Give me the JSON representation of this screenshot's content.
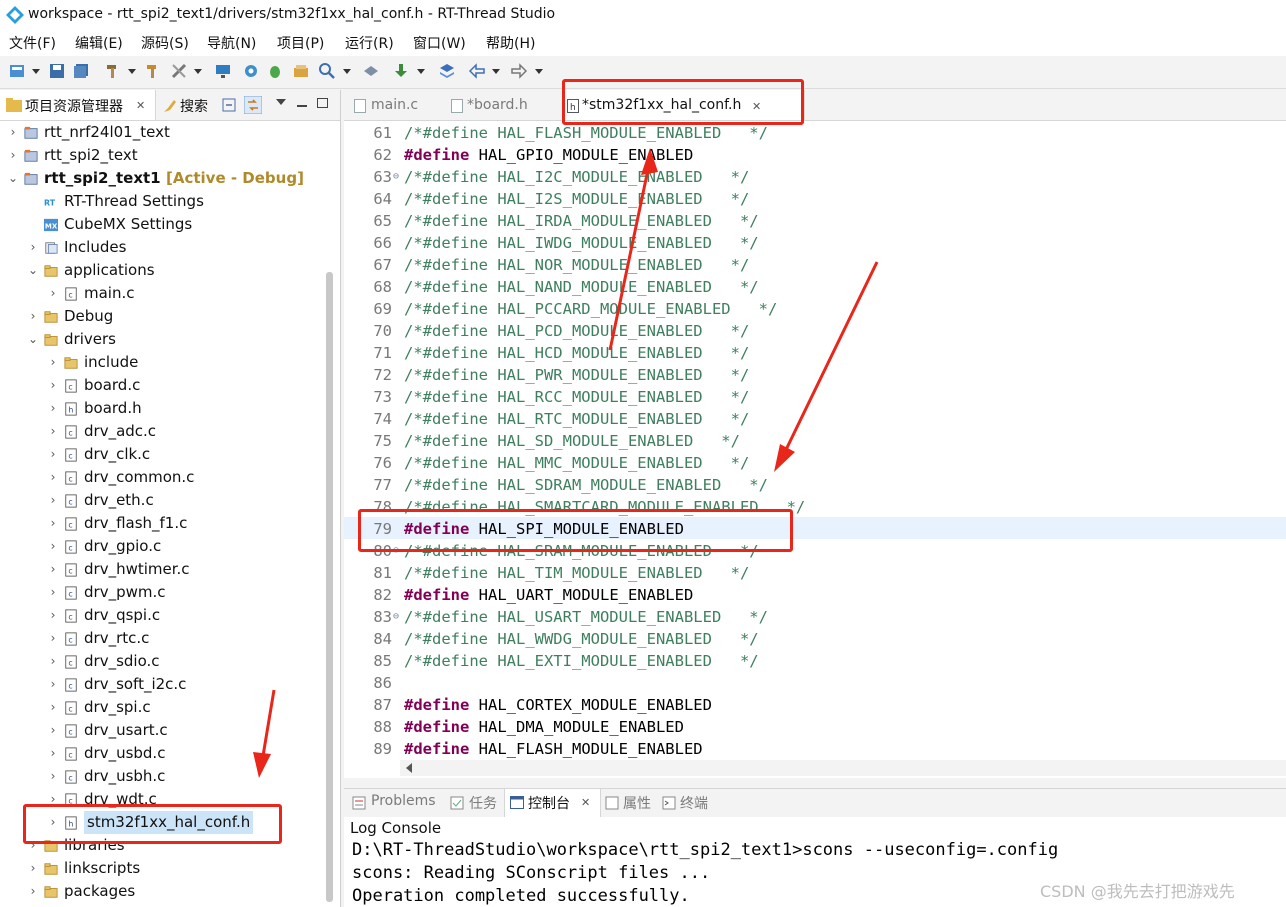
{
  "window": {
    "title": "workspace - rtt_spi2_text1/drivers/stm32f1xx_hal_conf.h - RT-Thread Studio"
  },
  "menu": [
    "文件(F)",
    "编辑(E)",
    "源码(S)",
    "导航(N)",
    "项目(P)",
    "运行(R)",
    "窗口(W)",
    "帮助(H)"
  ],
  "left_tabs": {
    "explorer": "项目资源管理器",
    "explorer_close": "✕",
    "search": "搜索"
  },
  "tree": [
    {
      "label": "rtt_nrf24l01_text",
      "chev": "›",
      "icon": "project",
      "indent": 0
    },
    {
      "label": "rtt_spi2_text",
      "chev": "›",
      "icon": "project",
      "indent": 0
    },
    {
      "label": "rtt_spi2_text1",
      "chev": "⌄",
      "icon": "project",
      "indent": 0,
      "bold": true,
      "suffix": "[Active - Debug]"
    },
    {
      "label": "RT-Thread Settings",
      "chev": "",
      "icon": "rt",
      "indent": 1
    },
    {
      "label": "CubeMX Settings",
      "chev": "",
      "icon": "mx",
      "indent": 1
    },
    {
      "label": "Includes",
      "chev": "›",
      "icon": "includes",
      "indent": 1
    },
    {
      "label": "applications",
      "chev": "⌄",
      "icon": "folder",
      "indent": 1
    },
    {
      "label": "main.c",
      "chev": "›",
      "icon": "c",
      "indent": 2
    },
    {
      "label": "Debug",
      "chev": "›",
      "icon": "folder",
      "indent": 1
    },
    {
      "label": "drivers",
      "chev": "⌄",
      "icon": "folder",
      "indent": 1
    },
    {
      "label": "include",
      "chev": "›",
      "icon": "folder",
      "indent": 2
    },
    {
      "label": "board.c",
      "chev": "›",
      "icon": "c",
      "indent": 2
    },
    {
      "label": "board.h",
      "chev": "›",
      "icon": "h",
      "indent": 2
    },
    {
      "label": "drv_adc.c",
      "chev": "›",
      "icon": "c",
      "indent": 2
    },
    {
      "label": "drv_clk.c",
      "chev": "›",
      "icon": "c",
      "indent": 2
    },
    {
      "label": "drv_common.c",
      "chev": "›",
      "icon": "c",
      "indent": 2
    },
    {
      "label": "drv_eth.c",
      "chev": "›",
      "icon": "c",
      "indent": 2
    },
    {
      "label": "drv_flash_f1.c",
      "chev": "›",
      "icon": "c",
      "indent": 2
    },
    {
      "label": "drv_gpio.c",
      "chev": "›",
      "icon": "c",
      "indent": 2
    },
    {
      "label": "drv_hwtimer.c",
      "chev": "›",
      "icon": "c",
      "indent": 2
    },
    {
      "label": "drv_pwm.c",
      "chev": "›",
      "icon": "c",
      "indent": 2
    },
    {
      "label": "drv_qspi.c",
      "chev": "›",
      "icon": "c",
      "indent": 2
    },
    {
      "label": "drv_rtc.c",
      "chev": "›",
      "icon": "c",
      "indent": 2
    },
    {
      "label": "drv_sdio.c",
      "chev": "›",
      "icon": "c",
      "indent": 2
    },
    {
      "label": "drv_soft_i2c.c",
      "chev": "›",
      "icon": "c",
      "indent": 2
    },
    {
      "label": "drv_spi.c",
      "chev": "›",
      "icon": "c",
      "indent": 2
    },
    {
      "label": "drv_usart.c",
      "chev": "›",
      "icon": "c",
      "indent": 2
    },
    {
      "label": "drv_usbd.c",
      "chev": "›",
      "icon": "c",
      "indent": 2
    },
    {
      "label": "drv_usbh.c",
      "chev": "›",
      "icon": "c",
      "indent": 2
    },
    {
      "label": "drv_wdt.c",
      "chev": "›",
      "icon": "c",
      "indent": 2
    },
    {
      "label": "stm32f1xx_hal_conf.h",
      "chev": "›",
      "icon": "h",
      "indent": 2,
      "selected": true
    },
    {
      "label": "libraries",
      "chev": "›",
      "icon": "folder",
      "indent": 1
    },
    {
      "label": "linkscripts",
      "chev": "›",
      "icon": "folder",
      "indent": 1
    },
    {
      "label": "packages",
      "chev": "›",
      "icon": "folder",
      "indent": 1
    }
  ],
  "editor_tabs": {
    "tab1": "main.c",
    "tab2": "*board.h",
    "tab3": "*stm32f1xx_hal_conf.h",
    "close": "✕"
  },
  "code": [
    {
      "n": "61",
      "t": "c",
      "s": "/*#define HAL_FLASH_MODULE_ENABLED   */"
    },
    {
      "n": "62",
      "t": "d",
      "s": "HAL_GPIO_MODULE_ENABLED"
    },
    {
      "n": "63",
      "t": "c",
      "s": "/*#define HAL_I2C_MODULE_ENABLED   */",
      "fold": true
    },
    {
      "n": "64",
      "t": "c",
      "s": "/*#define HAL_I2S_MODULE_ENABLED   */"
    },
    {
      "n": "65",
      "t": "c",
      "s": "/*#define HAL_IRDA_MODULE_ENABLED   */"
    },
    {
      "n": "66",
      "t": "c",
      "s": "/*#define HAL_IWDG_MODULE_ENABLED   */"
    },
    {
      "n": "67",
      "t": "c",
      "s": "/*#define HAL_NOR_MODULE_ENABLED   */"
    },
    {
      "n": "68",
      "t": "c",
      "s": "/*#define HAL_NAND_MODULE_ENABLED   */"
    },
    {
      "n": "69",
      "t": "c",
      "s": "/*#define HAL_PCCARD_MODULE_ENABLED   */"
    },
    {
      "n": "70",
      "t": "c",
      "s": "/*#define HAL_PCD_MODULE_ENABLED   */"
    },
    {
      "n": "71",
      "t": "c",
      "s": "/*#define HAL_HCD_MODULE_ENABLED   */"
    },
    {
      "n": "72",
      "t": "c",
      "s": "/*#define HAL_PWR_MODULE_ENABLED   */"
    },
    {
      "n": "73",
      "t": "c",
      "s": "/*#define HAL_RCC_MODULE_ENABLED   */"
    },
    {
      "n": "74",
      "t": "c",
      "s": "/*#define HAL_RTC_MODULE_ENABLED   */"
    },
    {
      "n": "75",
      "t": "c",
      "s": "/*#define HAL_SD_MODULE_ENABLED   */"
    },
    {
      "n": "76",
      "t": "c",
      "s": "/*#define HAL_MMC_MODULE_ENABLED   */"
    },
    {
      "n": "77",
      "t": "c",
      "s": "/*#define HAL_SDRAM_MODULE_ENABLED   */"
    },
    {
      "n": "78",
      "t": "c",
      "s": "/*#define HAL_SMARTCARD_MODULE_ENABLED   */"
    },
    {
      "n": "79",
      "t": "d",
      "s": "HAL_SPI_MODULE_ENABLED",
      "current": true
    },
    {
      "n": "80",
      "t": "c",
      "s": "/*#define HAL_SRAM_MODULE_ENABLED   */",
      "fold": true
    },
    {
      "n": "81",
      "t": "c",
      "s": "/*#define HAL_TIM_MODULE_ENABLED   */"
    },
    {
      "n": "82",
      "t": "d",
      "s": "HAL_UART_MODULE_ENABLED"
    },
    {
      "n": "83",
      "t": "c",
      "s": "/*#define HAL_USART_MODULE_ENABLED   */",
      "fold": true
    },
    {
      "n": "84",
      "t": "c",
      "s": "/*#define HAL_WWDG_MODULE_ENABLED   */"
    },
    {
      "n": "85",
      "t": "c",
      "s": "/*#define HAL_EXTI_MODULE_ENABLED   */"
    },
    {
      "n": "86",
      "t": "e",
      "s": ""
    },
    {
      "n": "87",
      "t": "d",
      "s": "HAL_CORTEX_MODULE_ENABLED"
    },
    {
      "n": "88",
      "t": "d",
      "s": "HAL_DMA_MODULE_ENABLED"
    },
    {
      "n": "89",
      "t": "d",
      "s": "HAL_FLASH_MODULE_ENABLED"
    }
  ],
  "keyword": "#define",
  "bottom_tabs": {
    "problems": "Problems",
    "tasks": "任务",
    "console": "控制台",
    "console_close": "✕",
    "properties": "属性",
    "terminal": "终端"
  },
  "console": {
    "title": "Log Console",
    "lines": [
      "D:\\RT-ThreadStudio\\workspace\\rtt_spi2_text1>scons --useconfig=.config",
      "scons: Reading SConscript files ...",
      "Operation completed successfully."
    ]
  },
  "watermark": "CSDN @我先去打把游戏先",
  "colors": {
    "annotation": "#e8261a",
    "keyword": "#7f0055",
    "comment": "#3f7f5f"
  }
}
